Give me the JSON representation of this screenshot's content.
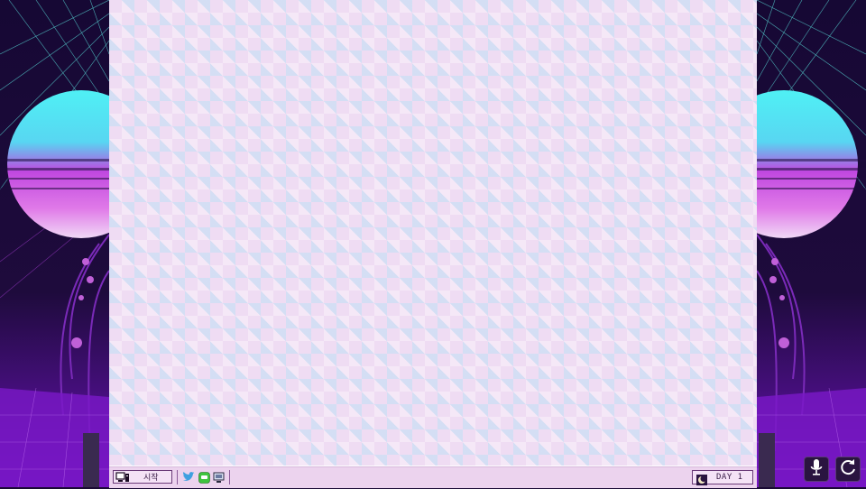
{
  "taskbar": {
    "start_label": "시작",
    "start_icon": "computer-icon",
    "quick_launch": [
      "twitter-icon",
      "chat-icon",
      "monitor-icon"
    ],
    "clock": {
      "day_label": "DAY 1",
      "icon": "moon-icon"
    }
  },
  "corner_buttons": [
    "microphone-icon",
    "refresh-icon"
  ],
  "colors": {
    "desktop_bg": "#efdcf3",
    "taskbar_bg": "#ecd3ee",
    "border": "#6a3a78",
    "twitter": "#3fa0e0",
    "chat": "#3ec43e"
  }
}
